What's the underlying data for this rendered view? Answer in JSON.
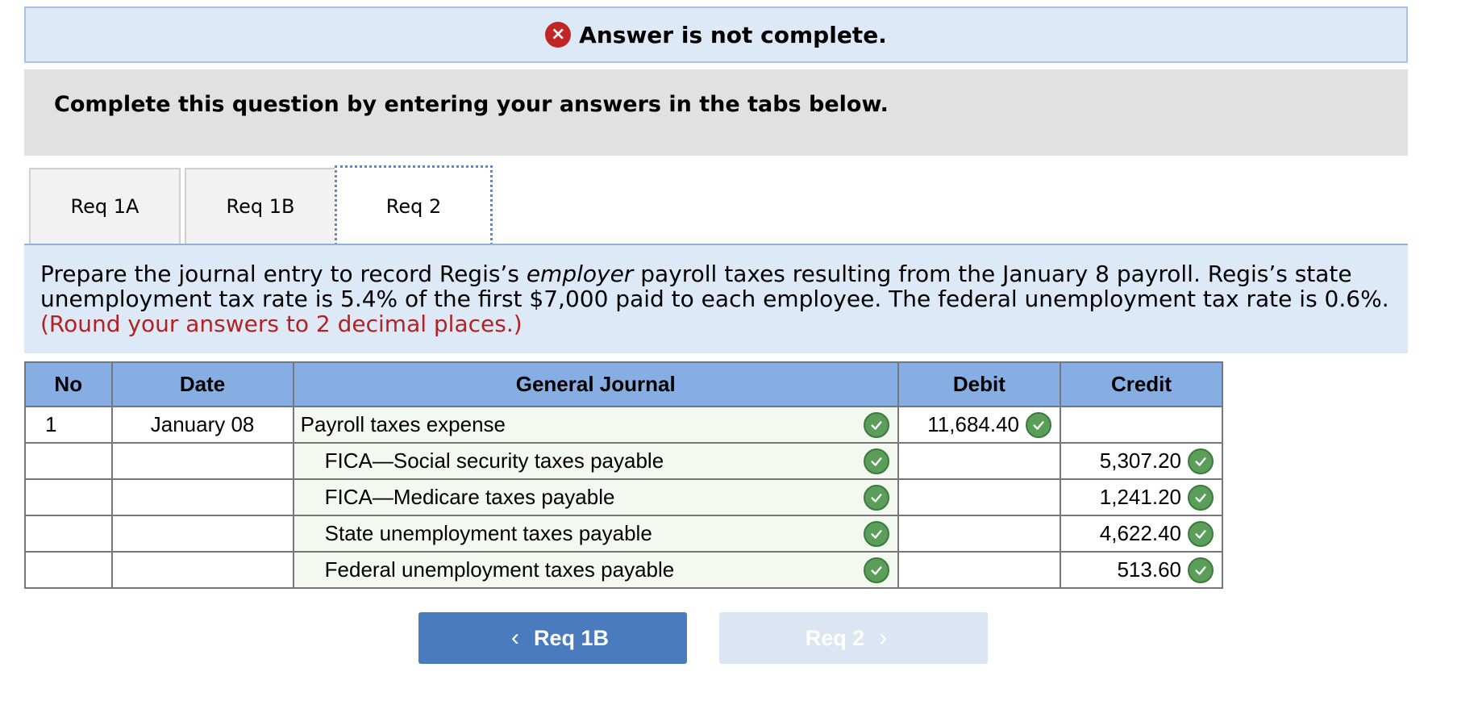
{
  "banner": {
    "text": "Answer is not complete.",
    "icon": "x-circle-icon"
  },
  "instructions": {
    "text": "Complete this question by entering your answers in the tabs below."
  },
  "tabs": [
    {
      "label": "Req 1A",
      "active": false
    },
    {
      "label": "Req 1B",
      "active": false
    },
    {
      "label": "Req 2",
      "active": true
    }
  ],
  "prompt": {
    "part1": "Prepare the journal entry to record Regis’s ",
    "emphasis": "employer",
    "part2": " payroll taxes resulting from the January 8 payroll. Regis’s state unemployment tax rate is 5.4% of the first $7,000 paid to each employee. The federal unemployment tax rate is 0.6%.",
    "note": "(Round your answers to 2 decimal places.)"
  },
  "journal": {
    "headers": {
      "no": "No",
      "date": "Date",
      "general_journal": "General Journal",
      "debit": "Debit",
      "credit": "Credit"
    },
    "rows": [
      {
        "no": "1",
        "date": "January 08",
        "account": "Payroll taxes expense",
        "debit": "11,684.40",
        "credit": ""
      },
      {
        "no": "",
        "date": "",
        "account": "FICA—Social security taxes payable",
        "debit": "",
        "credit": "5,307.20"
      },
      {
        "no": "",
        "date": "",
        "account": "FICA—Medicare taxes payable",
        "debit": "",
        "credit": "1,241.20"
      },
      {
        "no": "",
        "date": "",
        "account": "State unemployment taxes payable",
        "debit": "",
        "credit": "4,622.40"
      },
      {
        "no": "",
        "date": "",
        "account": "Federal unemployment taxes payable",
        "debit": "",
        "credit": "513.60"
      }
    ]
  },
  "nav": {
    "prev_label": "Req 1B",
    "next_label": "Req 2",
    "prev_chevron": "‹",
    "next_chevron": "›"
  },
  "colors": {
    "accent": "#4a7bbf",
    "error": "#c12626",
    "correct": "#5a9e5a"
  }
}
